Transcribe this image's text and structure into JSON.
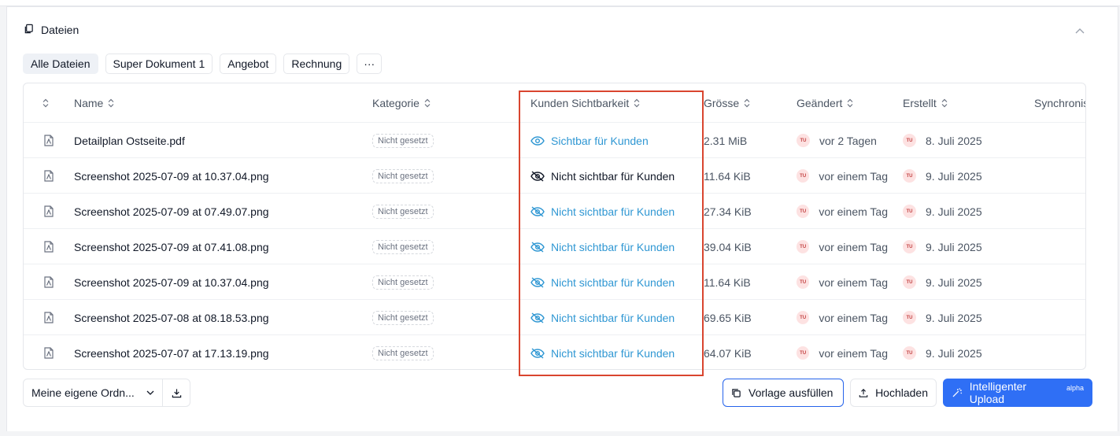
{
  "section": {
    "title": "Dateien"
  },
  "filters": [
    "Alle Dateien",
    "Super Dokument 1",
    "Angebot",
    "Rechnung"
  ],
  "filter_more": "···",
  "columns": {
    "name": "Name",
    "category": "Kategorie",
    "visibility": "Kunden Sichtbarkeit",
    "size": "Grösse",
    "modified": "Geändert",
    "created": "Erstellt",
    "sync": "Synchronisiert"
  },
  "rows": [
    {
      "name": "Detailplan Ostseite.pdf",
      "category": "Nicht gesetzt",
      "visibility": "Sichtbar für Kunden",
      "size": "2.31 MiB",
      "avatar": "TU",
      "modified": "vor 2 Tagen",
      "created": "8. Juli 2025"
    },
    {
      "name": "Screenshot 2025-07-09 at 10.37.04.png",
      "category": "Nicht gesetzt",
      "visibility": "Nicht sichtbar für Kunden",
      "size": "11.64 KiB",
      "avatar": "TU",
      "modified": "vor einem Tag",
      "created": "9. Juli 2025"
    },
    {
      "name": "Screenshot 2025-07-09 at 07.49.07.png",
      "category": "Nicht gesetzt",
      "visibility": "Nicht sichtbar für Kunden",
      "size": "27.34 KiB",
      "avatar": "TU",
      "modified": "vor einem Tag",
      "created": "9. Juli 2025"
    },
    {
      "name": "Screenshot 2025-07-09 at 07.41.08.png",
      "category": "Nicht gesetzt",
      "visibility": "Nicht sichtbar für Kunden",
      "size": "39.04 KiB",
      "avatar": "TU",
      "modified": "vor einem Tag",
      "created": "9. Juli 2025"
    },
    {
      "name": "Screenshot 2025-07-09 at 10.37.04.png",
      "category": "Nicht gesetzt",
      "visibility": "Nicht sichtbar für Kunden",
      "size": "11.64 KiB",
      "avatar": "TU",
      "modified": "vor einem Tag",
      "created": "9. Juli 2025"
    },
    {
      "name": "Screenshot 2025-07-08 at 08.18.53.png",
      "category": "Nicht gesetzt",
      "visibility": "Nicht sichtbar für Kunden",
      "size": "69.65 KiB",
      "avatar": "TU",
      "modified": "vor einem Tag",
      "created": "9. Juli 2025"
    },
    {
      "name": "Screenshot 2025-07-07 at 17.13.19.png",
      "category": "Nicht gesetzt",
      "visibility": "Nicht sichtbar für Kunden",
      "size": "64.07 KiB",
      "avatar": "TU",
      "modified": "vor einem Tag",
      "created": "9. Juli 2025"
    }
  ],
  "footer": {
    "folder_select": "Meine eigene Ordn...",
    "fill_template": "Vorlage ausfüllen",
    "upload": "Hochladen",
    "smart_upload": "Intelligenter Upload",
    "smart_upload_tag": "alpha"
  },
  "colors": {
    "accent": "#2f6ff5",
    "visible_link": "#2f97d3",
    "highlight": "#d9452f"
  }
}
